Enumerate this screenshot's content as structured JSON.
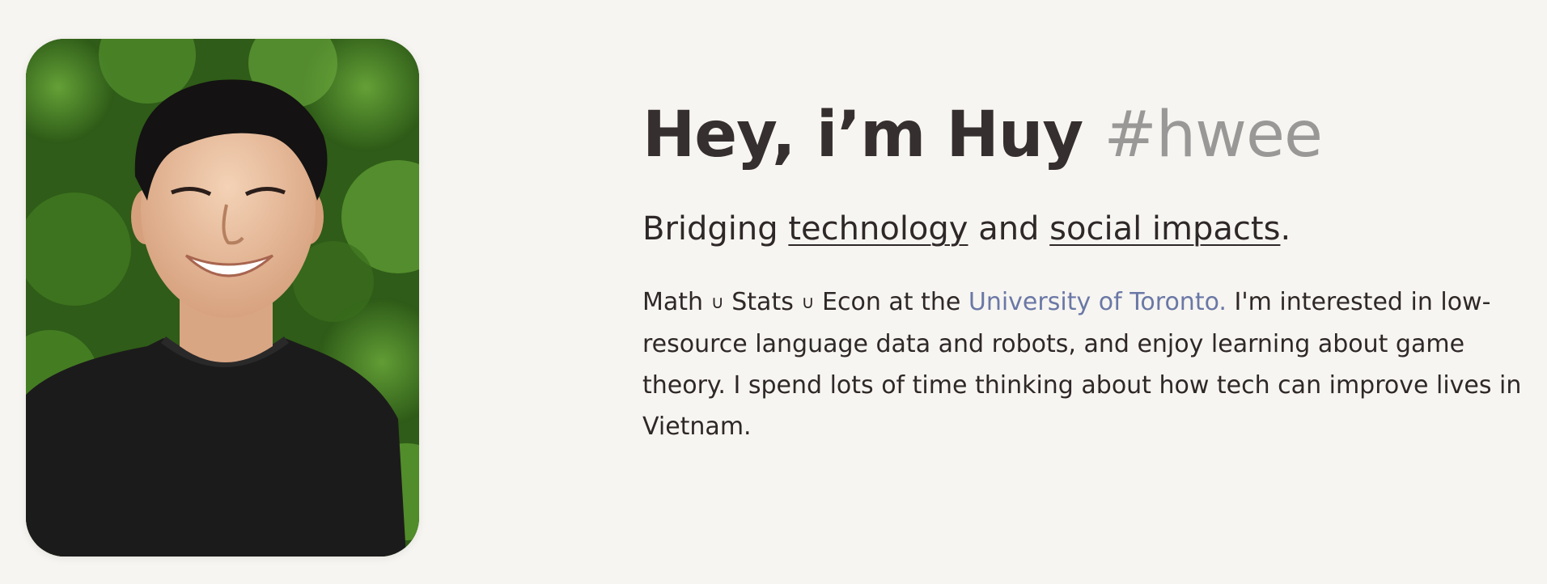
{
  "profile": {
    "photo_alt": "Portrait photo of Huy",
    "colors": {
      "background": "#f7f5f1",
      "text": "#362f2f",
      "handle": "#9a9897",
      "link": "#6a78a6"
    }
  },
  "headline": {
    "greeting": "Hey, i’m Huy",
    "handle": "#hwee"
  },
  "tagline": {
    "prefix": "Bridging",
    "link1": "technology",
    "middle": "and",
    "link2": "social impacts",
    "suffix": "."
  },
  "bio": {
    "part1": "Math",
    "union": "∪",
    "part2": "Stats",
    "part3": "Econ at the",
    "university": "University of Toronto.",
    "rest": "I'm interested in low-resource language data and robots, and enjoy learning about game theory. I spend lots of time thinking about how tech can improve lives in Vietnam."
  }
}
